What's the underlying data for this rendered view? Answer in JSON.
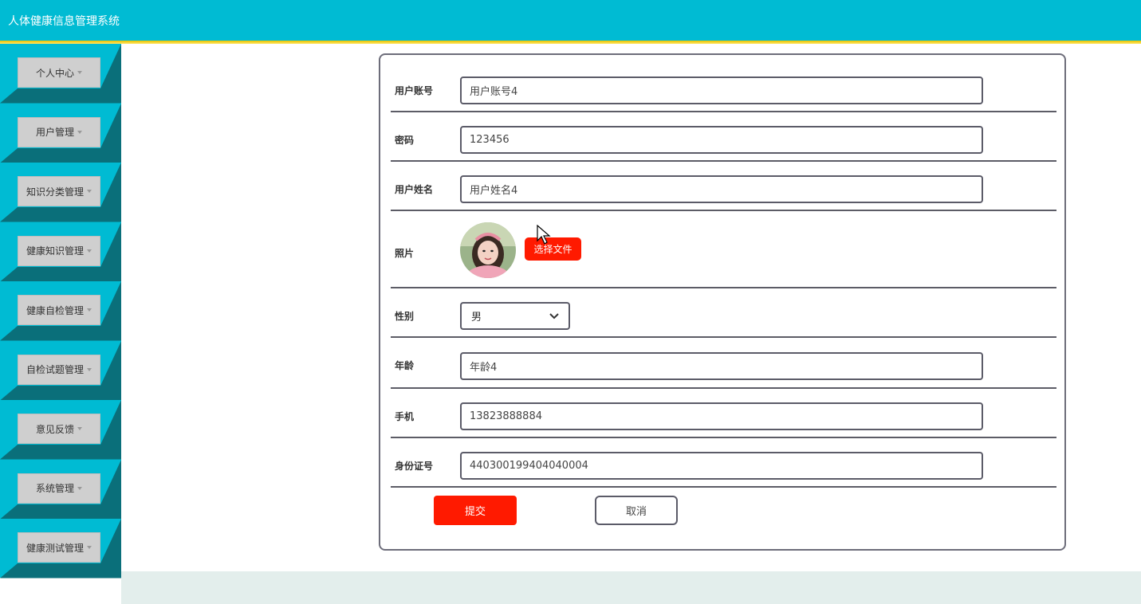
{
  "app": {
    "title": "人体健康信息管理系统"
  },
  "colors": {
    "header": "#00bbd3",
    "accent_line": "#f2d000",
    "primary_button": "#ff1a00",
    "sidebar_shadow": "#0a6f7a"
  },
  "sidebar": {
    "items": [
      {
        "label": "个人中心"
      },
      {
        "label": "用户管理"
      },
      {
        "label": "知识分类管理"
      },
      {
        "label": "健康知识管理"
      },
      {
        "label": "健康自检管理"
      },
      {
        "label": "自检试题管理"
      },
      {
        "label": "意见反馈"
      },
      {
        "label": "系统管理"
      },
      {
        "label": "健康测试管理"
      }
    ]
  },
  "form": {
    "account": {
      "label": "用户账号",
      "value": "用户账号4"
    },
    "password": {
      "label": "密码",
      "value": "123456"
    },
    "name": {
      "label": "用户姓名",
      "value": "用户姓名4"
    },
    "photo": {
      "label": "照片",
      "button": "选择文件"
    },
    "gender": {
      "label": "性别",
      "value": "男"
    },
    "age": {
      "label": "年龄",
      "value": "年龄4"
    },
    "phone": {
      "label": "手机",
      "value": "13823888884"
    },
    "idcard": {
      "label": "身份证号",
      "value": "440300199404040004"
    },
    "submit": "提交",
    "cancel": "取消"
  }
}
